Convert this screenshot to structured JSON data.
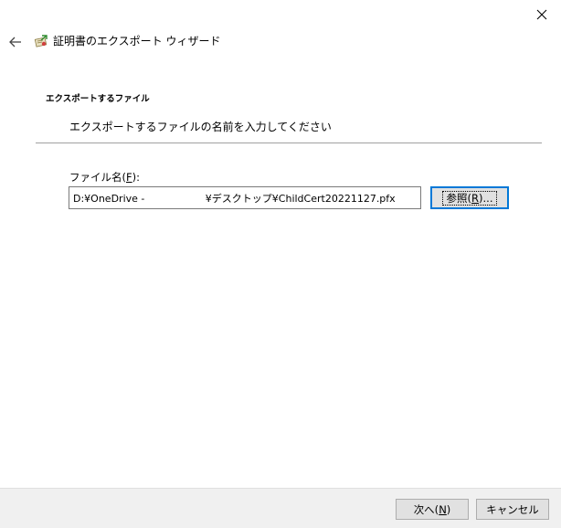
{
  "window": {
    "title": "証明書のエクスポート ウィザード",
    "close_icon": "close-icon",
    "back_icon": "back-arrow-icon",
    "wizard_icon": "certificate-icon"
  },
  "page": {
    "heading": "エクスポートするファイル",
    "description": "エクスポートするファイルの名前を入力してください"
  },
  "form": {
    "filename_label_prefix": "ファイル名(",
    "filename_label_key": "F",
    "filename_label_suffix": "):",
    "filename_value": "D:¥OneDrive -                   ¥デスクトップ¥ChildCert20221127.pfx",
    "browse_prefix": "参照(",
    "browse_key": "R",
    "browse_suffix": ")..."
  },
  "footer": {
    "next_prefix": "次へ(",
    "next_key": "N",
    "next_suffix": ")",
    "cancel_label": "キャンセル"
  }
}
